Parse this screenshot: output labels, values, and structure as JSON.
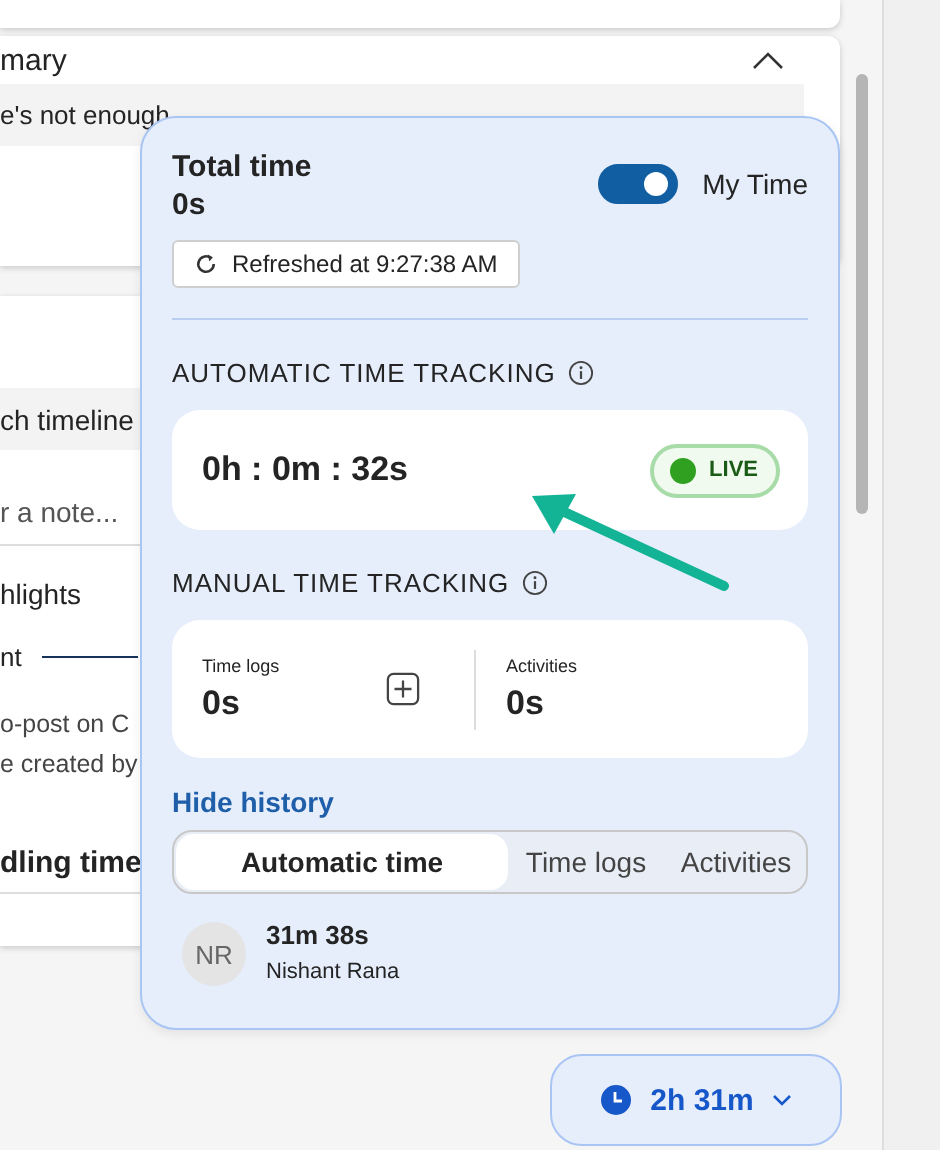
{
  "background": {
    "summary_title": "mary",
    "summary_text": "e's not enough",
    "timeline_label": "ch timeline",
    "note_placeholder": "r a note...",
    "highlights_label": "hlights",
    "tab_label": "nt",
    "post_lines": [
      "o-post on C",
      "e created by"
    ],
    "section_title": "dling time"
  },
  "popover": {
    "total_label": "Total time",
    "total_value": "0s",
    "toggle": {
      "label": "My Time",
      "on": true
    },
    "refresh_button": "Refreshed at 9:27:38 AM",
    "automatic": {
      "title": "AUTOMATIC TIME TRACKING",
      "timer": "0h : 0m : 32s",
      "status": "LIVE",
      "live": true
    },
    "manual": {
      "title": "MANUAL TIME TRACKING",
      "cells": [
        {
          "label": "Time logs",
          "value": "0s",
          "addable": true
        },
        {
          "label": "Activities",
          "value": "0s",
          "addable": false
        }
      ]
    },
    "history_link": "Hide history",
    "history_tabs": [
      {
        "label": "Automatic time",
        "selected": true
      },
      {
        "label": "Time logs",
        "selected": false
      },
      {
        "label": "Activities",
        "selected": false
      }
    ],
    "entries": [
      {
        "initials": "NR",
        "duration": "31m 38s",
        "name": "Nishant Rana"
      }
    ]
  },
  "footer_button": "2h 31m"
}
